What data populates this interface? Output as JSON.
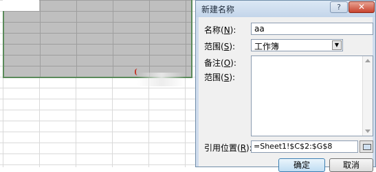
{
  "dialog": {
    "title": "新建名称",
    "help_label": "?",
    "close_label": "✕",
    "name_label": {
      "text": "名称(",
      "key": "N",
      "tail": "):"
    },
    "name_value": "aa",
    "scope_label": {
      "text": "范围(",
      "key": "S",
      "tail": "):"
    },
    "scope_value": "工作簿",
    "comment_label": {
      "text": "备注(",
      "key": "O",
      "tail": "):"
    },
    "scope_label_2": {
      "text": "范围(",
      "key": "S",
      "tail": "):"
    },
    "refers_to_label": {
      "text": "引用位置(",
      "key": "R",
      "tail": "):"
    },
    "refers_to_value": "=Sheet1!$C$2:$G$8",
    "ok_label": "确定",
    "cancel_label": "取消"
  },
  "colors": {
    "selection_fill": "#bfbfbf",
    "selection_border": "#5a8a5a",
    "dialog_frame": "#cfdced",
    "close_button": "#c8432e"
  }
}
